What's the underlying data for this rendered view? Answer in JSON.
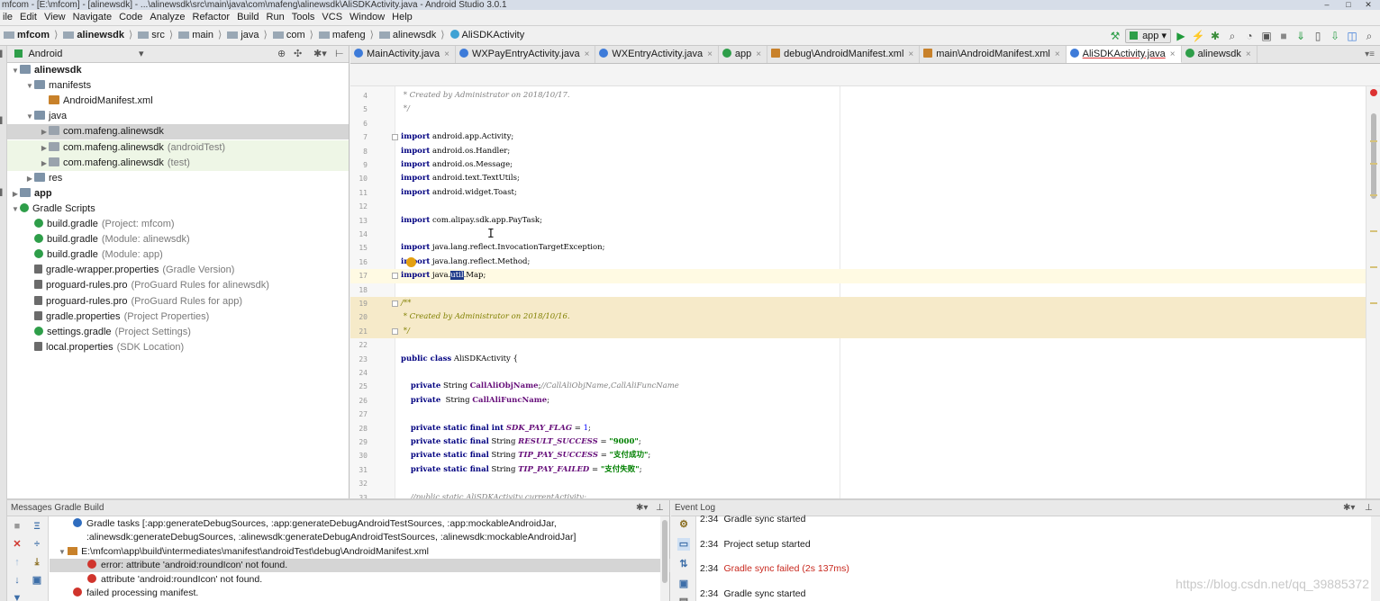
{
  "window": {
    "title": "mfcom - [E:\\mfcom] - [alinewsdk] - ...\\alinewsdk\\src\\main\\java\\com\\mafeng\\alinewsdk\\AliSDKActivity.java - Android Studio 3.0.1"
  },
  "menu": [
    "ile",
    "Edit",
    "View",
    "Navigate",
    "Code",
    "Analyze",
    "Refactor",
    "Build",
    "Run",
    "Tools",
    "VCS",
    "Window",
    "Help"
  ],
  "breadcrumb": [
    "mfcom",
    "alinewsdk",
    "src",
    "main",
    "java",
    "com",
    "mafeng",
    "alinewsdk",
    "AliSDKActivity"
  ],
  "toolbar": {
    "run_config": "app"
  },
  "project": {
    "view_mode": "Android",
    "tree": [
      {
        "label": "alinewsdk",
        "muted": "",
        "level": 0,
        "arrow": "▼",
        "icon": "module-folder-icon",
        "bold": true
      },
      {
        "label": "manifests",
        "muted": "",
        "level": 1,
        "arrow": "▼",
        "icon": "folder-icon"
      },
      {
        "label": "AndroidManifest.xml",
        "muted": "",
        "level": 2,
        "arrow": "",
        "icon": "xml-file-icon"
      },
      {
        "label": "java",
        "muted": "",
        "level": 1,
        "arrow": "▼",
        "icon": "folder-icon"
      },
      {
        "label": "com.mafeng.alinewsdk",
        "muted": "",
        "level": 2,
        "arrow": "▶",
        "icon": "package-icon",
        "state": "selected"
      },
      {
        "label": "com.mafeng.alinewsdk",
        "muted": "(androidTest)",
        "level": 2,
        "arrow": "▶",
        "icon": "package-icon",
        "state": "green"
      },
      {
        "label": "com.mafeng.alinewsdk",
        "muted": "(test)",
        "level": 2,
        "arrow": "▶",
        "icon": "package-icon",
        "state": "green"
      },
      {
        "label": "res",
        "muted": "",
        "level": 1,
        "arrow": "▶",
        "icon": "folder-icon"
      },
      {
        "label": "app",
        "muted": "",
        "level": 0,
        "arrow": "▶",
        "icon": "module-folder-icon",
        "bold": true
      },
      {
        "label": "Gradle Scripts",
        "muted": "",
        "level": 0,
        "arrow": "▼",
        "icon": "gradle-icon"
      },
      {
        "label": "build.gradle",
        "muted": "(Project: mfcom)",
        "level": 1,
        "arrow": "",
        "icon": "gradle-icon"
      },
      {
        "label": "build.gradle",
        "muted": "(Module: alinewsdk)",
        "level": 1,
        "arrow": "",
        "icon": "gradle-icon"
      },
      {
        "label": "build.gradle",
        "muted": "(Module: app)",
        "level": 1,
        "arrow": "",
        "icon": "gradle-icon"
      },
      {
        "label": "gradle-wrapper.properties",
        "muted": "(Gradle Version)",
        "level": 1,
        "arrow": "",
        "icon": "properties-file-icon"
      },
      {
        "label": "proguard-rules.pro",
        "muted": "(ProGuard Rules for alinewsdk)",
        "level": 1,
        "arrow": "",
        "icon": "text-file-icon"
      },
      {
        "label": "proguard-rules.pro",
        "muted": "(ProGuard Rules for app)",
        "level": 1,
        "arrow": "",
        "icon": "text-file-icon"
      },
      {
        "label": "gradle.properties",
        "muted": "(Project Properties)",
        "level": 1,
        "arrow": "",
        "icon": "properties-file-icon"
      },
      {
        "label": "settings.gradle",
        "muted": "(Project Settings)",
        "level": 1,
        "arrow": "",
        "icon": "gradle-icon"
      },
      {
        "label": "local.properties",
        "muted": "(SDK Location)",
        "level": 1,
        "arrow": "",
        "icon": "properties-file-icon"
      }
    ]
  },
  "tabs": [
    {
      "label": "MainActivity.java",
      "icon": "java-class-icon"
    },
    {
      "label": "WXPayEntryActivity.java",
      "icon": "java-class-icon"
    },
    {
      "label": "WXEntryActivity.java",
      "icon": "java-class-icon"
    },
    {
      "label": "app",
      "icon": "gradle-icon"
    },
    {
      "label": "debug\\AndroidManifest.xml",
      "icon": "xml-file-icon"
    },
    {
      "label": "main\\AndroidManifest.xml",
      "icon": "xml-file-icon"
    },
    {
      "label": "AliSDKActivity.java",
      "icon": "java-class-icon",
      "active": true
    },
    {
      "label": "alinewsdk",
      "icon": "gradle-icon"
    }
  ],
  "editor": {
    "lines": [
      {
        "n": "4",
        "html": "<span class=\"cm\"> * Created by Administrator on 2018/10/17.</span>"
      },
      {
        "n": "5",
        "html": "<span class=\"cm\"> */</span>"
      },
      {
        "n": "6",
        "html": ""
      },
      {
        "n": "7",
        "html": "<span class=\"kw\">import</span> android.app.Activity;"
      },
      {
        "n": "8",
        "html": "<span class=\"kw\">import</span> android.os.Handler;"
      },
      {
        "n": "9",
        "html": "<span class=\"kw\">import</span> android.os.Message;"
      },
      {
        "n": "10",
        "html": "<span class=\"kw\">import</span> android.text.TextUtils;"
      },
      {
        "n": "11",
        "html": "<span class=\"kw\">import</span> android.widget.Toast;"
      },
      {
        "n": "12",
        "html": ""
      },
      {
        "n": "13",
        "html": "<span class=\"kw\">import</span> com.alipay.sdk.app.PayTask;"
      },
      {
        "n": "14",
        "html": ""
      },
      {
        "n": "15",
        "html": "<span class=\"kw\">import</span> java.lang.reflect.InvocationTargetException;"
      },
      {
        "n": "16",
        "html": "<span class=\"kw\">import</span> java.lang.reflect.Method;"
      },
      {
        "n": "17",
        "html": "<span class=\"kw\">import</span> java.<span class=\"selword\">util</span>.Map;"
      },
      {
        "n": "18",
        "html": ""
      },
      {
        "n": "19",
        "html": "<span class=\"cm-doc\">/**</span>"
      },
      {
        "n": "20",
        "html": "<span class=\"cm-doc\"> * Created by Administrator on 2018/10/16.</span>"
      },
      {
        "n": "21",
        "html": "<span class=\"cm-doc\"> */</span>"
      },
      {
        "n": "22",
        "html": ""
      },
      {
        "n": "23",
        "html": "<span class=\"kw\">public class</span> AliSDKActivity {"
      },
      {
        "n": "24",
        "html": ""
      },
      {
        "n": "25",
        "html": "    <span class=\"kw\">private</span> String <span class=\"fld\" style=\"font-style:normal\">CallAliObjName</span>;<span class=\"cm\">//CallAliObjName,CallAliFuncName</span>"
      },
      {
        "n": "26",
        "html": "    <span class=\"kw\">private</span>  String <span class=\"fld\" style=\"font-style:normal\">CallAliFuncName</span>;"
      },
      {
        "n": "27",
        "html": ""
      },
      {
        "n": "28",
        "html": "    <span class=\"kw\">private static final int</span> <span class=\"fld\">SDK_PAY_FLAG</span> = <span class=\"num\">1</span>;"
      },
      {
        "n": "29",
        "html": "    <span class=\"kw\">private static final</span> String <span class=\"fld\">RESULT_SUCCESS</span> = <span class=\"str\">\"9000\"</span>;"
      },
      {
        "n": "30",
        "html": "    <span class=\"kw\">private static final</span> String <span class=\"fld\">TIP_PAY_SUCCESS</span> = <span class=\"str\">\"支付成功\"</span>;"
      },
      {
        "n": "31",
        "html": "    <span class=\"kw\">private static final</span> String <span class=\"fld\">TIP_PAY_FAILED</span> = <span class=\"str\">\"支付失败\"</span>;"
      },
      {
        "n": "32",
        "html": ""
      },
      {
        "n": "33",
        "html": "    <span class=\"cm\">//public static AliSDKActivity currentActivity;</span>"
      }
    ]
  },
  "messages": {
    "header": "Messages Gradle Build",
    "rows": [
      {
        "icon": "info",
        "indent": 0,
        "text": "Gradle tasks [:app:generateDebugSources, :app:generateDebugAndroidTestSources, :app:mockableAndroidJar,"
      },
      {
        "icon": "",
        "indent": 0,
        "text": ":alinewsdk:generateDebugSources, :alinewsdk:generateDebugAndroidTestSources, :alinewsdk:mockableAndroidJar]"
      },
      {
        "icon": "folder",
        "indent": -1,
        "text": "E:\\mfcom\\app\\build\\intermediates\\manifest\\androidTest\\debug\\AndroidManifest.xml"
      },
      {
        "icon": "error",
        "indent": 1,
        "text": "error: attribute 'android:roundIcon' not found.",
        "selected": true
      },
      {
        "icon": "error",
        "indent": 1,
        "text": "attribute 'android:roundIcon' not found."
      },
      {
        "icon": "error",
        "indent": 0,
        "text": "failed processing manifest."
      }
    ]
  },
  "event_log": {
    "header": "Event Log",
    "rows": [
      {
        "time": "2:34",
        "text": "Gradle sync started",
        "fail": false
      },
      {
        "time": "2:34",
        "text": "Project setup started",
        "fail": false
      },
      {
        "time": "2:34",
        "text": "Gradle sync failed (2s 137ms)",
        "fail": true
      },
      {
        "time": "2:34",
        "text": "Gradle sync started",
        "fail": false
      }
    ],
    "watermark": "https://blog.csdn.net/qq_39885372"
  }
}
